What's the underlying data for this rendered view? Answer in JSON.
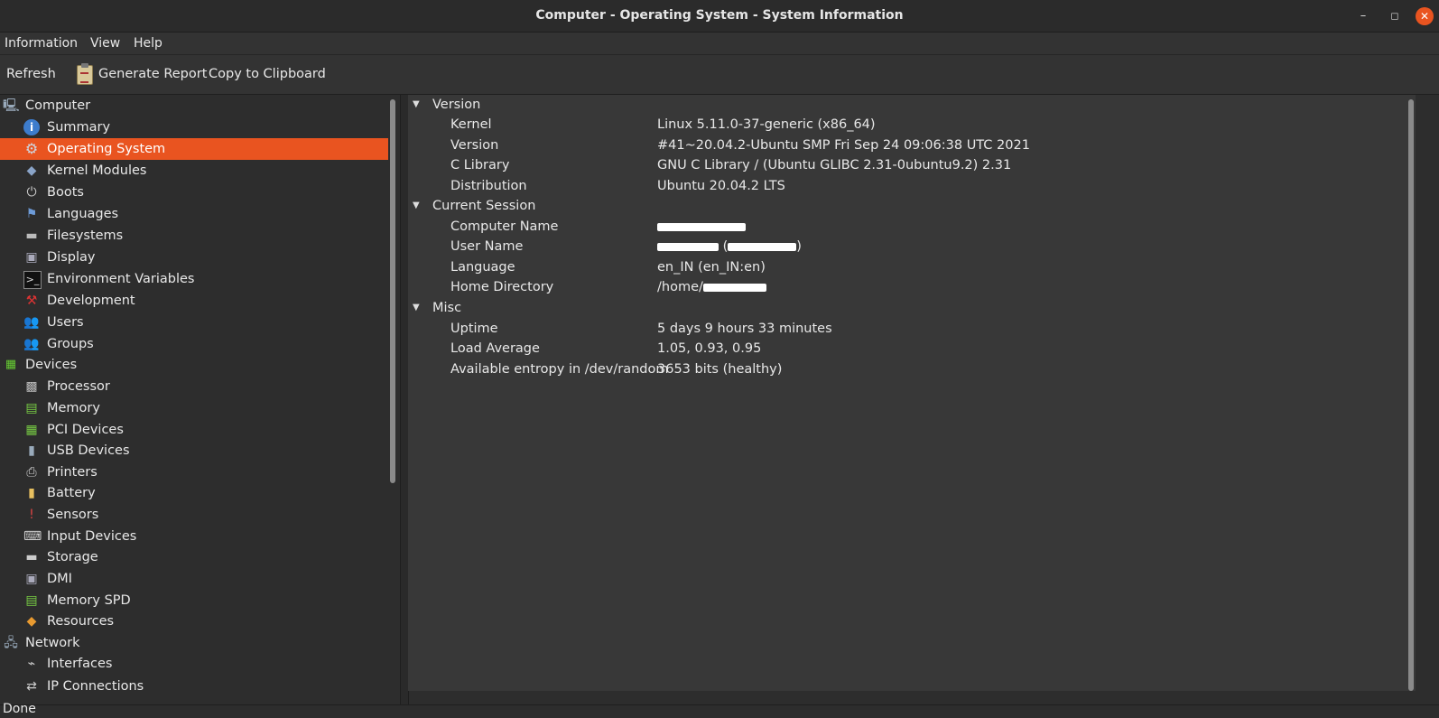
{
  "window": {
    "title": "Computer - Operating System - System Information",
    "min": "–",
    "max": "◻",
    "close": "✕"
  },
  "menubar": [
    "Information",
    "View",
    "Help"
  ],
  "toolbar": {
    "refresh": "Refresh",
    "generate_report": "Generate Report",
    "copy_clipboard": "Copy to Clipboard"
  },
  "sidebar": {
    "groups": [
      {
        "label": "Computer",
        "icon": "computer-icon"
      },
      {
        "label": "Devices",
        "icon": "devices-icon"
      },
      {
        "label": "Network",
        "icon": "network-icon"
      }
    ],
    "computer_items": [
      {
        "label": "Summary",
        "icon": "info-icon"
      },
      {
        "label": "Operating System",
        "icon": "gear-icon",
        "selected": true
      },
      {
        "label": "Kernel Modules",
        "icon": "kernel-module-icon"
      },
      {
        "label": "Boots",
        "icon": "power-icon"
      },
      {
        "label": "Languages",
        "icon": "flag-icon"
      },
      {
        "label": "Filesystems",
        "icon": "drive-icon"
      },
      {
        "label": "Display",
        "icon": "monitor-icon"
      },
      {
        "label": "Environment Variables",
        "icon": "terminal-icon"
      },
      {
        "label": "Development",
        "icon": "development-icon"
      },
      {
        "label": "Users",
        "icon": "users-icon"
      },
      {
        "label": "Groups",
        "icon": "groups-icon"
      }
    ],
    "device_items": [
      {
        "label": "Processor",
        "icon": "cpu-icon"
      },
      {
        "label": "Memory",
        "icon": "memory-icon"
      },
      {
        "label": "PCI Devices",
        "icon": "pci-icon"
      },
      {
        "label": "USB Devices",
        "icon": "usb-icon"
      },
      {
        "label": "Printers",
        "icon": "printer-icon"
      },
      {
        "label": "Battery",
        "icon": "battery-icon"
      },
      {
        "label": "Sensors",
        "icon": "sensor-icon"
      },
      {
        "label": "Input Devices",
        "icon": "input-device-icon"
      },
      {
        "label": "Storage",
        "icon": "storage-icon"
      },
      {
        "label": "DMI",
        "icon": "dmi-icon"
      },
      {
        "label": "Memory SPD",
        "icon": "memory-spd-icon"
      },
      {
        "label": "Resources",
        "icon": "resources-icon"
      }
    ],
    "network_items": [
      {
        "label": "Interfaces",
        "icon": "interfaces-icon"
      },
      {
        "label": "IP Connections",
        "icon": "ip-connections-icon"
      }
    ]
  },
  "details": {
    "sections": [
      {
        "title": "Version",
        "rows": [
          {
            "key": "Kernel",
            "value": "Linux 5.11.0-37-generic (x86_64)"
          },
          {
            "key": "Version",
            "value": "#41~20.04.2-Ubuntu SMP Fri Sep 24 09:06:38 UTC 2021"
          },
          {
            "key": "C Library",
            "value": "GNU C Library / (Ubuntu GLIBC 2.31-0ubuntu9.2) 2.31"
          },
          {
            "key": "Distribution",
            "value": "Ubuntu 20.04.2 LTS"
          }
        ]
      },
      {
        "title": "Current Session",
        "rows": [
          {
            "key": "Computer Name",
            "value": ""
          },
          {
            "key": "User Name",
            "value": ""
          },
          {
            "key": "Language",
            "value": "en_IN (en_IN:en)"
          },
          {
            "key": "Home Directory",
            "value": "/home/"
          }
        ]
      },
      {
        "title": "Misc",
        "rows": [
          {
            "key": "Uptime",
            "value": "5 days 9 hours 33 minutes"
          },
          {
            "key": "Load Average",
            "value": "1.05, 0.93, 0.95"
          },
          {
            "key": "Available entropy in /dev/random",
            "value": "3653 bits (healthy)"
          }
        ]
      }
    ]
  },
  "status": "Done",
  "colors": {
    "accent": "#e95420",
    "background": "#2d2d2d",
    "content_bg": "#383838"
  }
}
